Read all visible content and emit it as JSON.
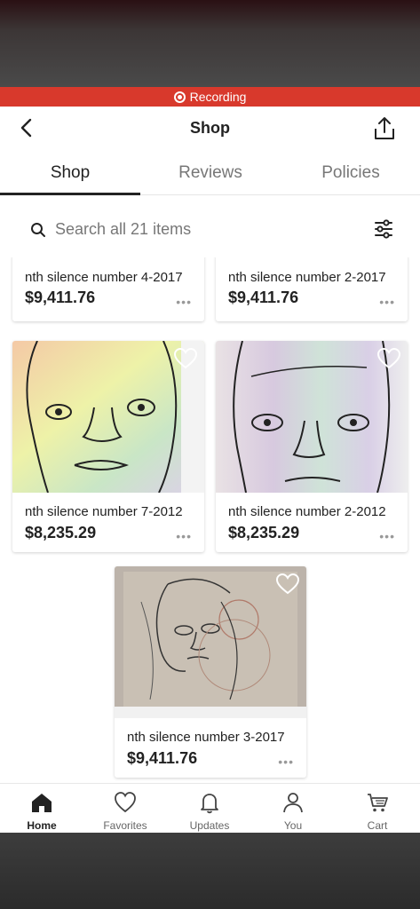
{
  "recording": {
    "label": "Recording"
  },
  "header": {
    "title": "Shop"
  },
  "tabs": [
    {
      "label": "Shop",
      "active": true
    },
    {
      "label": "Reviews",
      "active": false
    },
    {
      "label": "Policies",
      "active": false
    }
  ],
  "search": {
    "placeholder": "Search all 21 items"
  },
  "listings": [
    {
      "title": "nth silence number 4-2017",
      "price": "$9,411.76"
    },
    {
      "title": "nth silence number 2-2017",
      "price": "$9,411.76"
    },
    {
      "title": "nth silence number 7-2012",
      "price": "$8,235.29"
    },
    {
      "title": "nth silence number 2-2012",
      "price": "$8,235.29"
    },
    {
      "title": "nth silence number 3-2017",
      "price": "$9,411.76"
    }
  ],
  "more_label": "•••",
  "bottom_nav": [
    {
      "label": "Home",
      "icon": "home-icon",
      "active": true
    },
    {
      "label": "Favorites",
      "icon": "heart-icon",
      "active": false
    },
    {
      "label": "Updates",
      "icon": "bell-icon",
      "active": false
    },
    {
      "label": "You",
      "icon": "person-icon",
      "active": false
    },
    {
      "label": "Cart",
      "icon": "cart-icon",
      "active": false
    }
  ],
  "colors": {
    "recording": "#d8392c",
    "text": "#222222",
    "muted": "#777777"
  }
}
